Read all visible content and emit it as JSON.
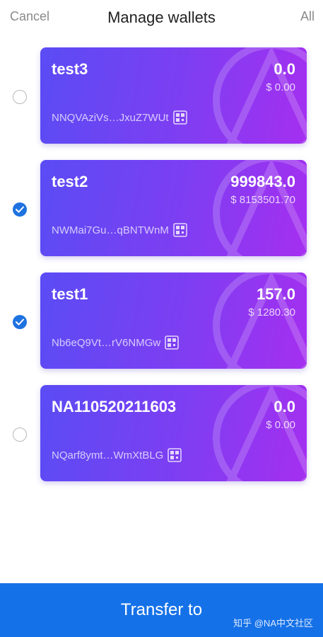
{
  "header": {
    "cancel_label": "Cancel",
    "title": "Manage wallets",
    "all_label": "All"
  },
  "wallets": [
    {
      "name": "test3",
      "balance": "0.0",
      "fiat": "$ 0.00",
      "address": "NNQVAziVs…JxuZ7WUt",
      "selected": false
    },
    {
      "name": "test2",
      "balance": "999843.0",
      "fiat": "$ 8153501.70",
      "address": "NWMai7Gu…qBNTWnM",
      "selected": true
    },
    {
      "name": "test1",
      "balance": "157.0",
      "fiat": "$ 1280.30",
      "address": "Nb6eQ9Vt…rV6NMGw",
      "selected": true
    },
    {
      "name": "NA110520211603",
      "balance": "0.0",
      "fiat": "$ 0.00",
      "address": "NQarf8ymt…WmXtBLG",
      "selected": false
    }
  ],
  "footer": {
    "transfer_label": "Transfer to",
    "watermark": "知乎 @NA中文社区"
  },
  "colors": {
    "accent": "#1571e8",
    "checked": "#1f73e0",
    "card_gradient_start": "#5a4cf4",
    "card_gradient_end": "#a52ff0"
  }
}
